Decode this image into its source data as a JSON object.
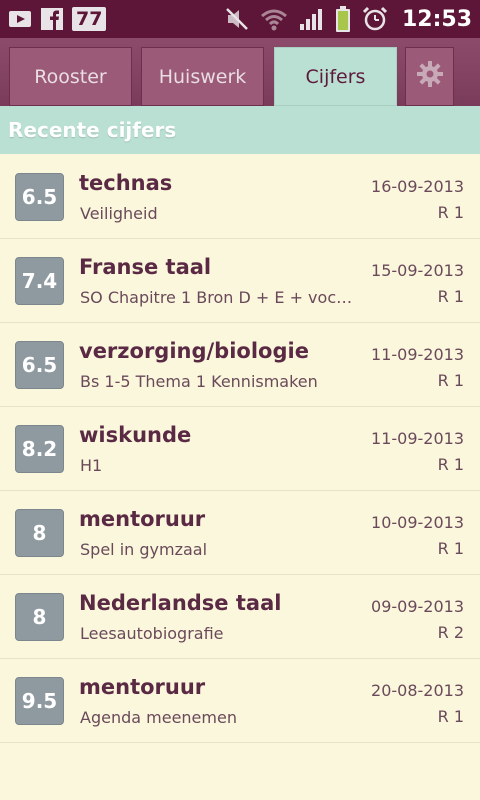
{
  "status_bar": {
    "notification_count": "77",
    "time": "12:53",
    "icons": [
      "youtube-icon",
      "facebook-icon",
      "mute-icon",
      "wifi-icon",
      "signal-icon",
      "battery-icon",
      "alarm-icon"
    ]
  },
  "tabs": [
    {
      "label": "Rooster",
      "active": false
    },
    {
      "label": "Huiswerk",
      "active": false
    },
    {
      "label": "Cijfers",
      "active": true
    }
  ],
  "settings_icon": "gear-icon",
  "section": {
    "title": "Recente cijfers"
  },
  "grades": [
    {
      "grade": "6.5",
      "subject": "technas",
      "description": "Veiligheid",
      "date": "16-09-2013",
      "period": "R 1"
    },
    {
      "grade": "7.4",
      "subject": "Franse taal",
      "description": "SO Chapitre 1 Bron D + E + voc…",
      "date": "15-09-2013",
      "period": "R 1"
    },
    {
      "grade": "6.5",
      "subject": "verzorging/biologie",
      "description": "Bs 1-5 Thema 1 Kennismaken",
      "date": "11-09-2013",
      "period": "R 1"
    },
    {
      "grade": "8.2",
      "subject": "wiskunde",
      "description": "H1",
      "date": "11-09-2013",
      "period": "R 1"
    },
    {
      "grade": "8",
      "subject": "mentoruur",
      "description": "Spel in gymzaal",
      "date": "10-09-2013",
      "period": "R 1"
    },
    {
      "grade": "8",
      "subject": "Nederlandse taal",
      "description": "Leesautobiografie",
      "date": "09-09-2013",
      "period": "R 2"
    },
    {
      "grade": "9.5",
      "subject": "mentoruur",
      "description": "Agenda meenemen",
      "date": "20-08-2013",
      "period": "R 1"
    }
  ],
  "colors": {
    "status_bar": "#5e1638",
    "tab_bar": "#8d4b6b",
    "tab_active": "#b9e0d3",
    "background": "#fbf7dc",
    "grade_badge": "#8e9aa0",
    "text_primary": "#5a2a44"
  }
}
